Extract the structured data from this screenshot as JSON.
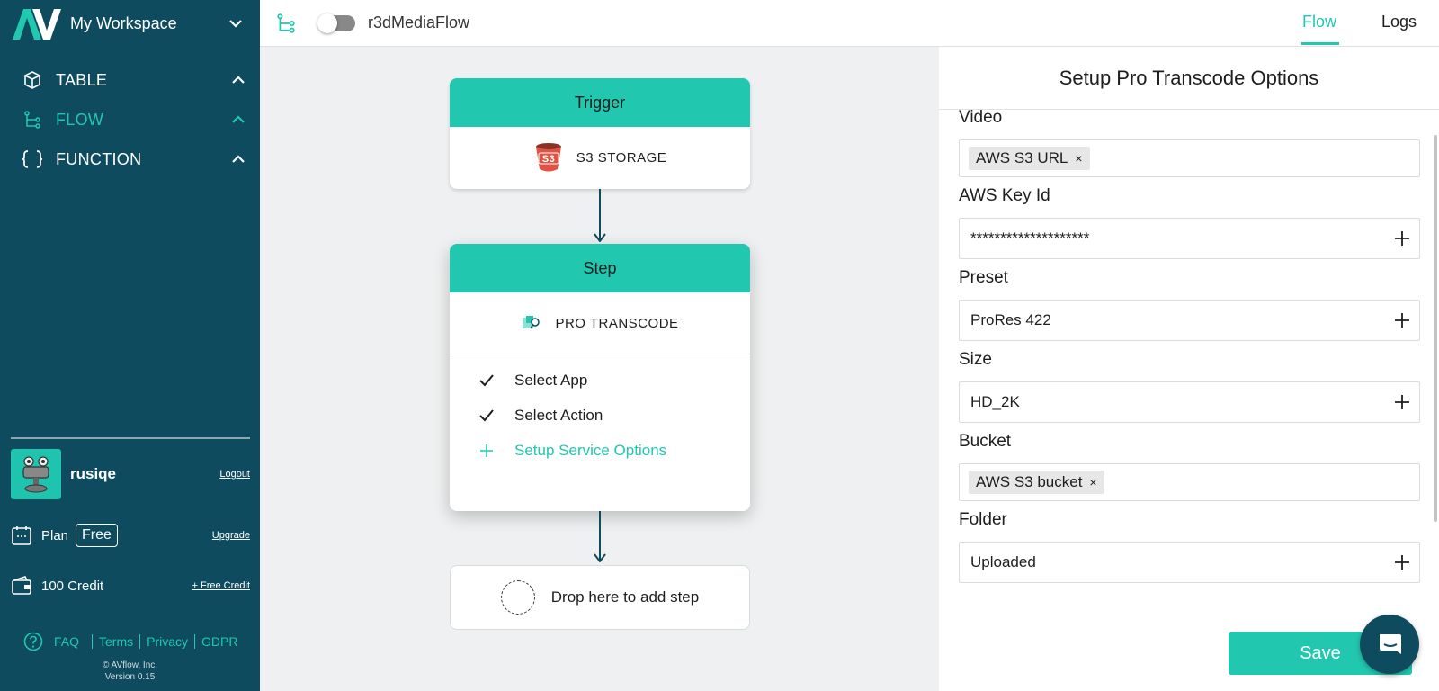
{
  "workspace": {
    "name": "My Workspace"
  },
  "sidebar": {
    "nav": [
      {
        "label": "TABLE"
      },
      {
        "label": "FLOW"
      },
      {
        "label": "FUNCTION"
      }
    ],
    "user": {
      "name": "rusiqe",
      "logout": "Logout"
    },
    "plan": {
      "label": "Plan",
      "tier": "Free",
      "upgrade": "Upgrade"
    },
    "credit": {
      "label": "100 Credit",
      "free_credit": "+ Free Credit"
    },
    "footer": {
      "faq": "FAQ",
      "terms": "Terms",
      "privacy": "Privacy",
      "gdpr": "GDPR"
    },
    "copyright": "© AVflow, Inc.",
    "version": "Version 0.15"
  },
  "topbar": {
    "flow_name": "r3dMediaFlow",
    "tabs": [
      "Flow",
      "Logs"
    ]
  },
  "canvas": {
    "trigger": {
      "header": "Trigger",
      "app": "S3 STORAGE",
      "app_icon_text": "S3"
    },
    "step": {
      "header": "Step",
      "app": "PRO TRANSCODE",
      "checklist": [
        {
          "label": "Select App",
          "done": true
        },
        {
          "label": "Select Action",
          "done": true
        },
        {
          "label": "Setup Service Options",
          "done": false
        }
      ]
    },
    "drop_text": "Drop here to add step"
  },
  "panel": {
    "title": "Setup Pro Transcode Options",
    "fields": {
      "video": {
        "label": "Video",
        "chip": "AWS S3 URL"
      },
      "aws_key": {
        "label": "AWS Key Id",
        "value": "********************"
      },
      "preset": {
        "label": "Preset",
        "value": "ProRes 422"
      },
      "size": {
        "label": "Size",
        "value": "HD_2K"
      },
      "bucket": {
        "label": "Bucket",
        "chip": "AWS S3 bucket"
      },
      "folder": {
        "label": "Folder",
        "value": "Uploaded"
      }
    },
    "save_label": "Save"
  },
  "colors": {
    "teal": "#22c7b0",
    "sidebar": "#0e4b5e"
  }
}
